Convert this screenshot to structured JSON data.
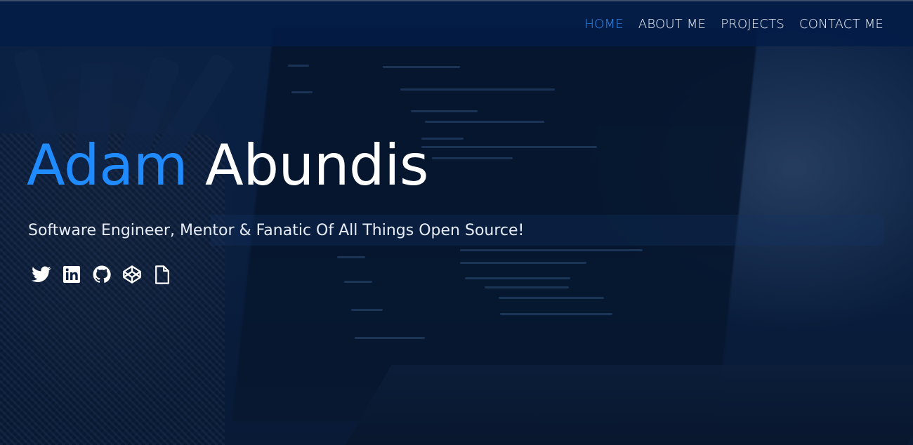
{
  "nav": {
    "items": [
      {
        "label": "HOME",
        "active": true
      },
      {
        "label": "ABOUT ME",
        "active": false
      },
      {
        "label": "PROJECTS",
        "active": false
      },
      {
        "label": "CONTACT ME",
        "active": false
      }
    ]
  },
  "hero": {
    "first_name": "Adam",
    "last_name": "Abundis",
    "subtitle": "Software Engineer, Mentor & Fanatic Of All Things Open Source!"
  },
  "socials": {
    "icons": [
      "twitter-icon",
      "linkedin-icon",
      "github-icon",
      "codepen-icon",
      "resume-icon"
    ]
  },
  "colors": {
    "accent": "#1f8bff",
    "nav_active": "#2f8cf2",
    "background": "#071a36"
  }
}
